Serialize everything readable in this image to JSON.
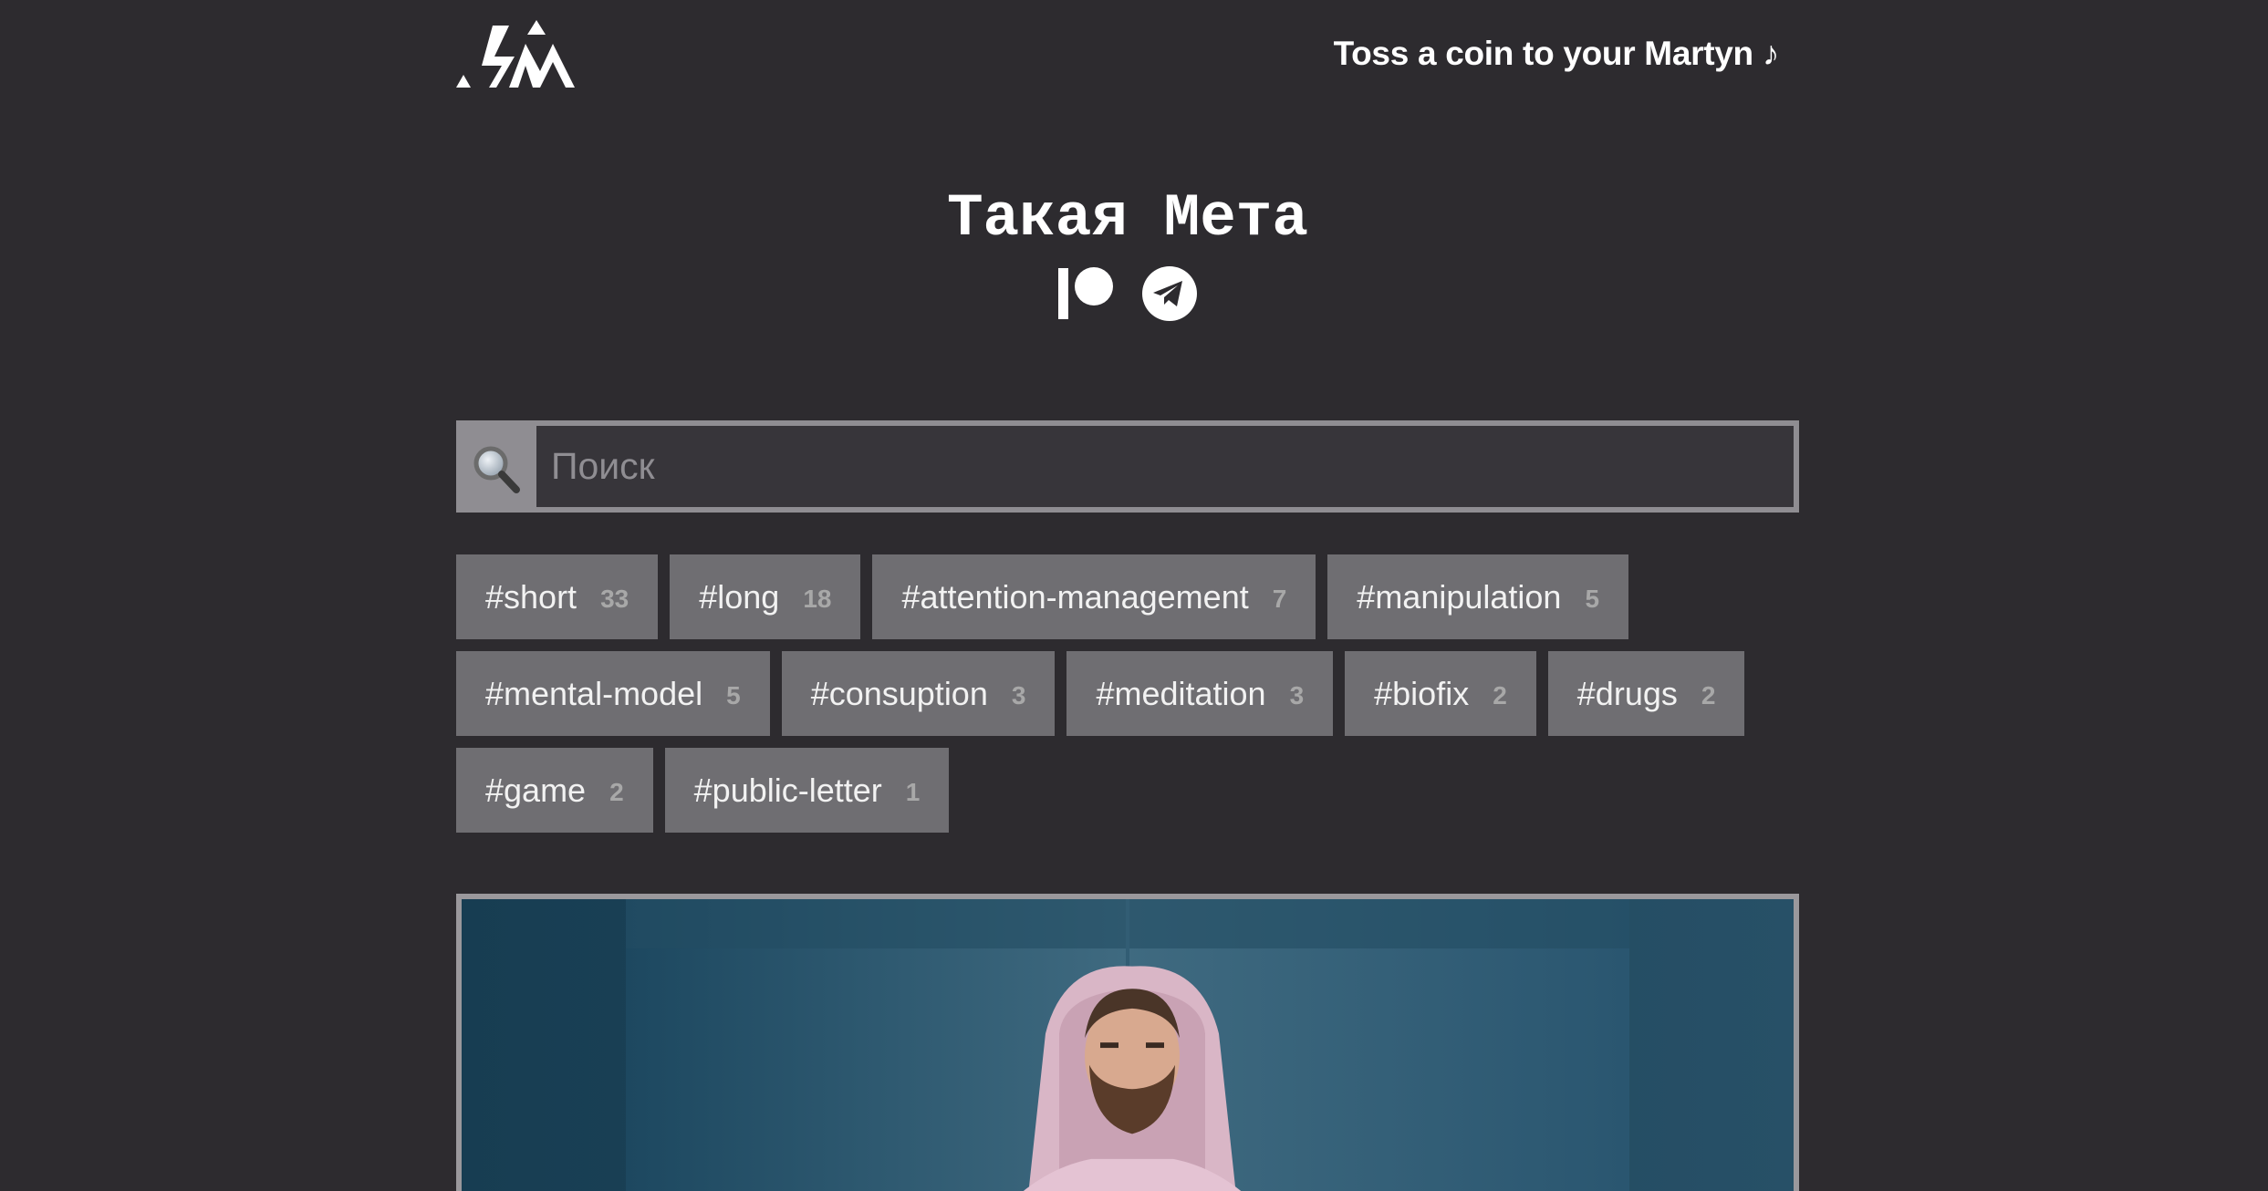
{
  "header": {
    "logo_icon": "site-logo-icon",
    "tagline": "Toss a coin to your Martyn ♪"
  },
  "title": "Такая Мета",
  "socials": [
    {
      "name": "patreon-icon"
    },
    {
      "name": "telegram-icon"
    }
  ],
  "search": {
    "icon": "magnifier-icon",
    "placeholder": "Поиск",
    "value": ""
  },
  "tags": [
    {
      "label": "#short",
      "count": "33"
    },
    {
      "label": "#long",
      "count": "18"
    },
    {
      "label": "#attention-management",
      "count": "7"
    },
    {
      "label": "#manipulation",
      "count": "5"
    },
    {
      "label": "#mental-model",
      "count": "5"
    },
    {
      "label": "#consuption",
      "count": "3"
    },
    {
      "label": "#meditation",
      "count": "3"
    },
    {
      "label": "#biofix",
      "count": "2"
    },
    {
      "label": "#drugs",
      "count": "2"
    },
    {
      "label": "#game",
      "count": "2"
    },
    {
      "label": "#public-letter",
      "count": "1"
    }
  ],
  "colors": {
    "background": "#2d2b2f",
    "tag_bg": "#6f6e72",
    "search_frame": "#8f8d92",
    "search_field": "#37353a"
  }
}
